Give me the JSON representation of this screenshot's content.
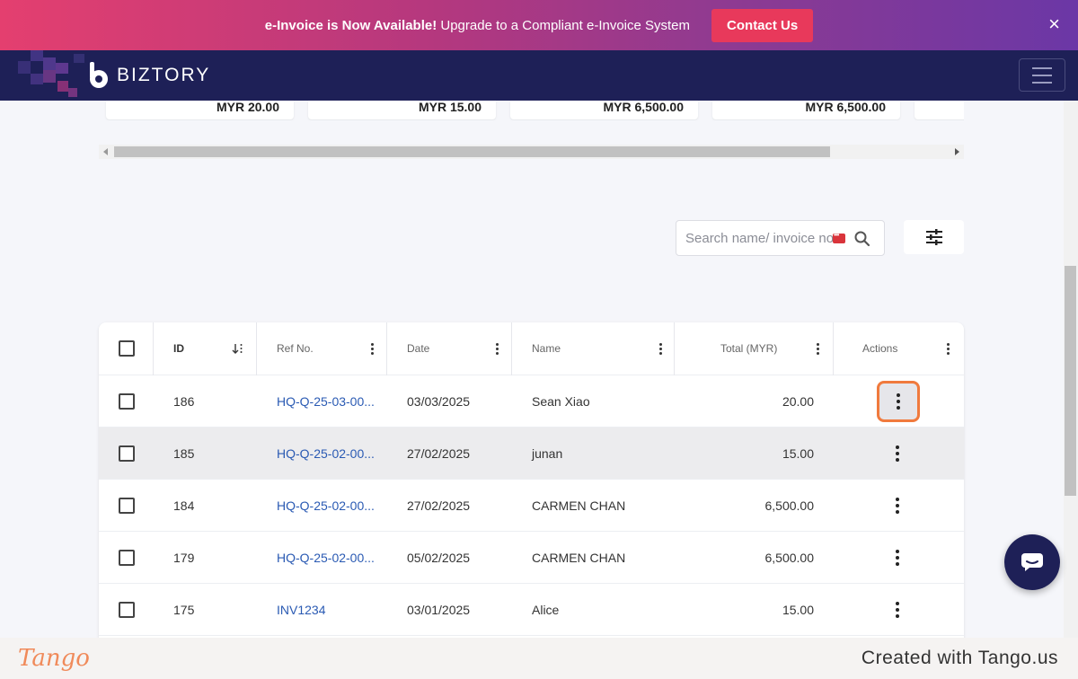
{
  "banner": {
    "bold_text": "e-Invoice is Now Available!",
    "text": " Upgrade to a Compliant e-Invoice System",
    "contact_label": "Contact Us",
    "close_icon": "×"
  },
  "brand": {
    "name": "BIZTORY"
  },
  "summary_cards": [
    {
      "amount": "MYR 20.00"
    },
    {
      "amount": "MYR 15.00"
    },
    {
      "amount": "MYR 6,500.00"
    },
    {
      "amount": "MYR 6,500.00"
    }
  ],
  "search": {
    "placeholder": "Search name/ invoice no."
  },
  "table": {
    "columns": {
      "id": "ID",
      "ref": "Ref No.",
      "date": "Date",
      "name": "Name",
      "total": "Total (MYR)",
      "actions": "Actions"
    },
    "rows": [
      {
        "id": "186",
        "ref": "HQ-Q-25-03-00...",
        "date": "03/03/2025",
        "name": "Sean Xiao",
        "total": "20.00"
      },
      {
        "id": "185",
        "ref": "HQ-Q-25-02-00...",
        "date": "27/02/2025",
        "name": "junan",
        "total": "15.00"
      },
      {
        "id": "184",
        "ref": "HQ-Q-25-02-00...",
        "date": "27/02/2025",
        "name": "CARMEN CHAN",
        "total": "6,500.00"
      },
      {
        "id": "179",
        "ref": "HQ-Q-25-02-00...",
        "date": "05/02/2025",
        "name": "CARMEN CHAN",
        "total": "6,500.00"
      },
      {
        "id": "175",
        "ref": "INV1234",
        "date": "03/01/2025",
        "name": "Alice",
        "total": "15.00"
      }
    ]
  },
  "footer": {
    "tango": "Tango",
    "created": "Created with Tango.us"
  },
  "colors": {
    "banner_start": "#e43f6f",
    "banner_end": "#6b37a6",
    "nav_bg": "#1e2057",
    "link": "#2a5ab3",
    "highlight": "#f07a3d"
  }
}
